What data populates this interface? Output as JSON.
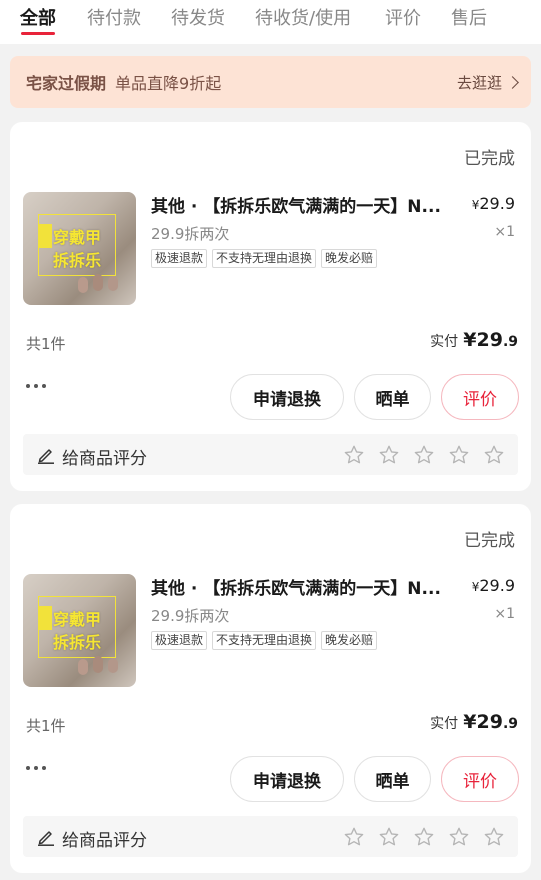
{
  "tabs": [
    {
      "label": "全部",
      "active": true
    },
    {
      "label": "待付款",
      "active": false
    },
    {
      "label": "待发货",
      "active": false
    },
    {
      "label": "待收货/使用",
      "active": false
    },
    {
      "label": "评价",
      "active": false
    },
    {
      "label": "售后",
      "active": false
    }
  ],
  "banner": {
    "title": "宅家过假期",
    "subtitle": "单品直降9折起",
    "link": "去逛逛"
  },
  "orders": [
    {
      "status": "已完成",
      "thumb_text_1": "穿戴甲",
      "thumb_text_2": "拆拆乐",
      "product_name": "其他 · 【拆拆乐欧气满满的一天】N...",
      "price_symbol": "¥",
      "price": "29.9",
      "quantity": "×1",
      "spec": "29.9拆两次",
      "tags": [
        "极速退款",
        "不支持无理由退换",
        "晚发必赔"
      ],
      "count": "共1件",
      "paid_label": "实付",
      "paid_symbol": "¥",
      "paid_int": "29",
      "paid_dec": ".9",
      "buttons": {
        "return": "申请退换",
        "show": "晒单",
        "review": "评价"
      },
      "rate_label": "给商品评分"
    },
    {
      "status": "已完成",
      "thumb_text_1": "穿戴甲",
      "thumb_text_2": "拆拆乐",
      "product_name": "其他 · 【拆拆乐欧气满满的一天】N...",
      "price_symbol": "¥",
      "price": "29.9",
      "quantity": "×1",
      "spec": "29.9拆两次",
      "tags": [
        "极速退款",
        "不支持无理由退换",
        "晚发必赔"
      ],
      "count": "共1件",
      "paid_label": "实付",
      "paid_symbol": "¥",
      "paid_int": "29",
      "paid_dec": ".9",
      "buttons": {
        "return": "申请退换",
        "show": "晒单",
        "review": "评价"
      },
      "rate_label": "给商品评分"
    }
  ],
  "icons": {
    "more": "more-dots-icon",
    "pen": "pen-icon",
    "star": "star-outline-icon",
    "chevron": "chevron-right-icon"
  },
  "colors": {
    "accent": "#e8233a",
    "banner_bg": "#fde3d5",
    "banner_text": "#7a5246"
  }
}
